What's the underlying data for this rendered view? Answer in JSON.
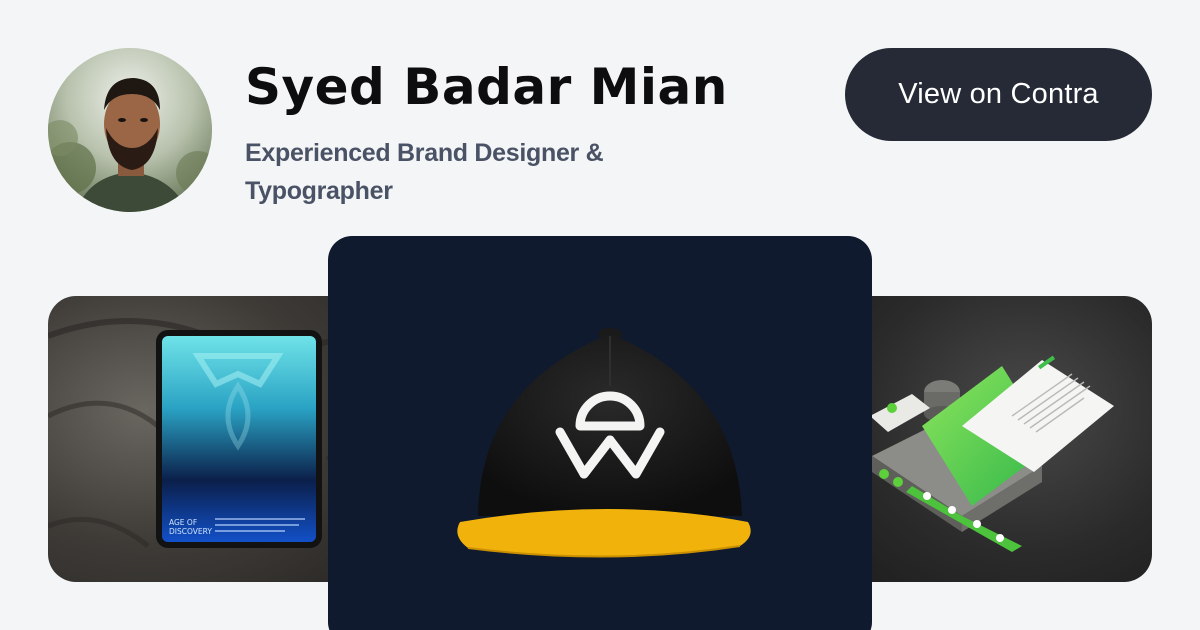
{
  "profile": {
    "name": "Syed Badar Mian",
    "title": "Experienced Brand Designer & Typographer"
  },
  "cta": {
    "label": "View on Contra"
  },
  "portfolio": {
    "left_card": {
      "poster_text": [
        "AGE OF",
        "DISCOVERY"
      ]
    }
  },
  "colors": {
    "background": "#f4f5f6",
    "name_text": "#0d0d10",
    "subtitle_text": "#4a5266",
    "button_bg": "#252a36",
    "button_text": "#ffffff",
    "center_card_bg": "#0f1a2e",
    "cap_visor": "#f2b20c",
    "brand_green": "#5ccf3a"
  }
}
